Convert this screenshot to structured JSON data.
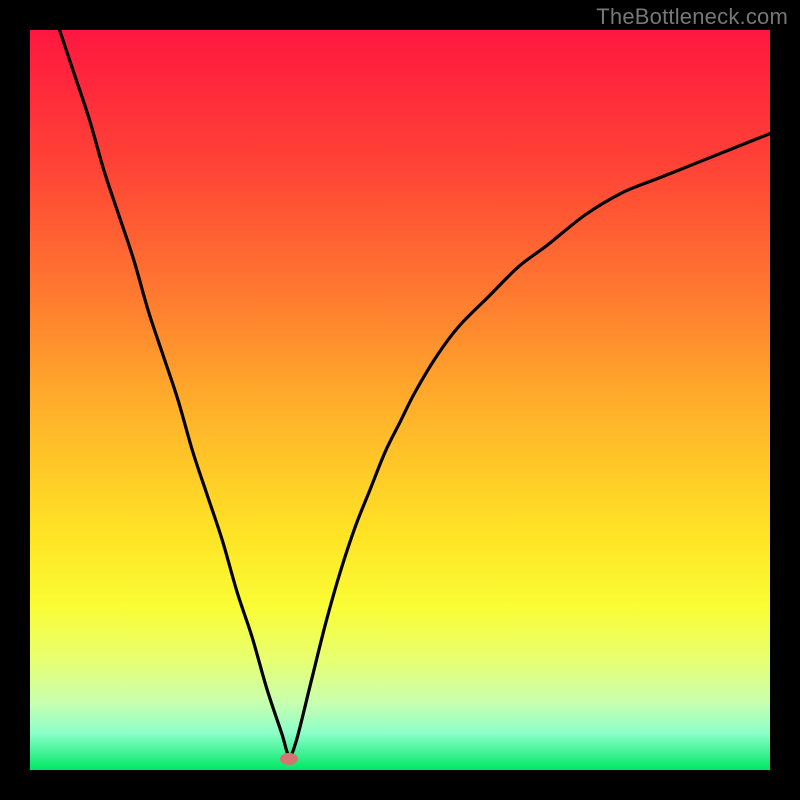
{
  "watermark": "TheBottleneck.com",
  "chart_data": {
    "type": "line",
    "title": "",
    "xlabel": "",
    "ylabel": "",
    "xlim": [
      0,
      100
    ],
    "ylim": [
      0,
      100
    ],
    "grid": false,
    "legend": false,
    "background_gradient": {
      "stops": [
        {
          "offset": 0.0,
          "color": "#ff173f"
        },
        {
          "offset": 0.18,
          "color": "#ff4236"
        },
        {
          "offset": 0.35,
          "color": "#ff7730"
        },
        {
          "offset": 0.52,
          "color": "#ffb32a"
        },
        {
          "offset": 0.68,
          "color": "#ffe325"
        },
        {
          "offset": 0.78,
          "color": "#fafd35"
        },
        {
          "offset": 0.85,
          "color": "#e8ff70"
        },
        {
          "offset": 0.91,
          "color": "#c7ffb0"
        },
        {
          "offset": 0.95,
          "color": "#8cffca"
        },
        {
          "offset": 1.0,
          "color": "#00e765"
        }
      ]
    },
    "series": [
      {
        "name": "bottleneck-curve",
        "x": [
          4,
          6,
          8,
          10,
          12,
          14,
          16,
          18,
          20,
          22,
          24,
          26,
          28,
          30,
          32,
          34,
          35,
          36,
          38,
          40,
          42,
          44,
          46,
          48,
          50,
          52,
          55,
          58,
          62,
          66,
          70,
          75,
          80,
          85,
          90,
          95,
          100
        ],
        "y": [
          100,
          94,
          88,
          81,
          75,
          69,
          62,
          56,
          50,
          43,
          37,
          31,
          24,
          18,
          11,
          5,
          2,
          4,
          12,
          20,
          27,
          33,
          38,
          43,
          47,
          51,
          56,
          60,
          64,
          68,
          71,
          75,
          78,
          80,
          82,
          84,
          86
        ]
      }
    ],
    "marker": {
      "name": "optimal-point",
      "x": 35,
      "y": 1.5,
      "color": "#d6756f",
      "rx": 9,
      "ry": 6
    }
  }
}
